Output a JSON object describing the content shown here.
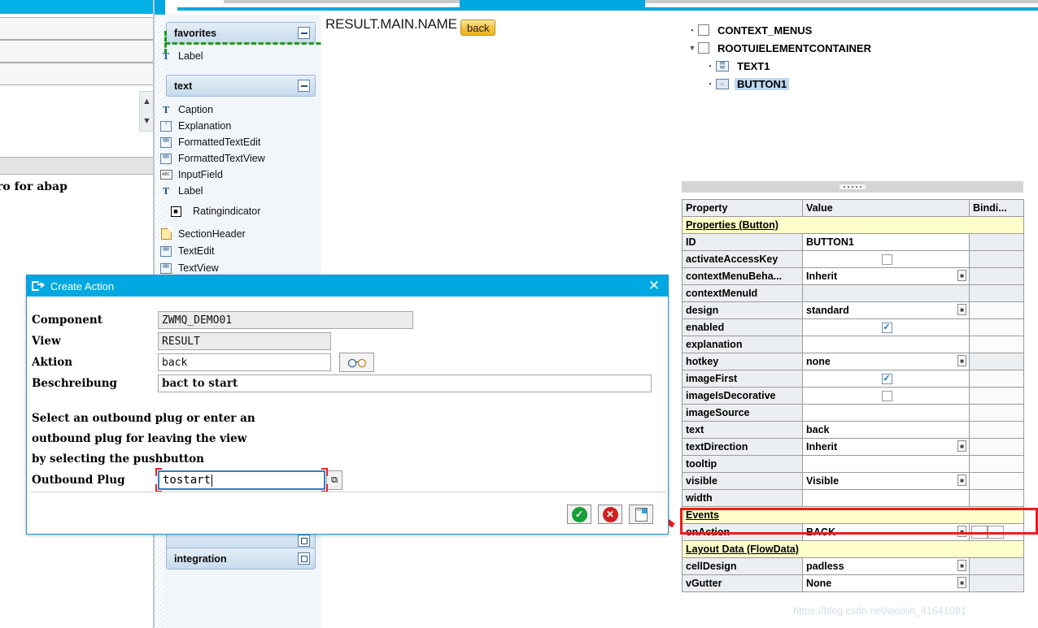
{
  "window": {
    "tabstrip_present": true,
    "watermark": "https://blog.csdn.net/weixin_41641081"
  },
  "far_left_panel": {
    "text_fragment": "ro for abap",
    "scroll_up_icon": "chevron-up-icon",
    "scroll_down_icon": "chevron-down-icon"
  },
  "palette": {
    "groups": [
      {
        "label": "favorites",
        "collapse_icon": "collapse-minus-icon"
      },
      {
        "label": "text",
        "collapse_icon": "collapse-minus-icon"
      },
      {
        "label": "integration",
        "collapse_icon": "expand-square-icon"
      }
    ],
    "favorites_items": [
      {
        "label": "Label",
        "icon": "text-T-icon"
      }
    ],
    "text_items": [
      {
        "label": "Caption",
        "icon": "text-T-icon"
      },
      {
        "label": "Explanation",
        "icon": "explanation-icon"
      },
      {
        "label": "FormattedTextEdit",
        "icon": "formatted-text-edit-icon"
      },
      {
        "label": "FormattedTextView",
        "icon": "formatted-text-view-icon"
      },
      {
        "label": "InputField",
        "icon": "input-field-icon"
      },
      {
        "label": "Label",
        "icon": "text-T-icon"
      },
      {
        "label": "Ratingindicator",
        "icon": "rating-indicator-icon"
      },
      {
        "label": "SectionHeader",
        "icon": "section-header-icon"
      },
      {
        "label": "TextEdit",
        "icon": "text-edit-icon"
      },
      {
        "label": "TextView",
        "icon": "text-view-icon"
      }
    ]
  },
  "canvas": {
    "view_label": "RESULT.MAIN.NAME",
    "button_text": "back"
  },
  "tree": {
    "nodes": [
      {
        "label": "CONTEXT_MENUS",
        "icon": "checkbox-icon",
        "selected": false,
        "expander": "dot",
        "indent": 0
      },
      {
        "label": "ROOTUIELEMENTCONTAINER",
        "icon": "checkbox-icon",
        "selected": false,
        "expander": "chevron-down-icon",
        "indent": 0
      },
      {
        "label": "TEXT1",
        "icon": "text-view-icon",
        "selected": false,
        "expander": "dot",
        "indent": 1
      },
      {
        "label": "BUTTON1",
        "icon": "button-icon",
        "selected": true,
        "expander": "dot",
        "indent": 1
      }
    ]
  },
  "properties": {
    "headers": [
      "Property",
      "Value",
      "Bindi..."
    ],
    "rows": [
      {
        "kind": "section",
        "name": "Properties (Button)"
      },
      {
        "kind": "text",
        "name": "ID",
        "value": "BUTTON1",
        "bind": false
      },
      {
        "kind": "checkbox",
        "name": "activateAccessKey",
        "checked": false,
        "bind": false
      },
      {
        "kind": "dropdown",
        "name": "contextMenuBeha...",
        "value": "Inherit",
        "bind": false
      },
      {
        "kind": "empty",
        "name": "contextMenuId",
        "value": "",
        "bind": false
      },
      {
        "kind": "dropdown",
        "name": "design",
        "value": "standard",
        "bind": true
      },
      {
        "kind": "checkbox",
        "name": "enabled",
        "checked": true,
        "bind": true
      },
      {
        "kind": "empty",
        "name": "explanation",
        "value": "",
        "bind": true
      },
      {
        "kind": "dropdown",
        "name": "hotkey",
        "value": "none",
        "bind": false
      },
      {
        "kind": "checkbox",
        "name": "imageFirst",
        "checked": true,
        "bind": true
      },
      {
        "kind": "checkbox",
        "name": "imageIsDecorative",
        "checked": false,
        "bind": true
      },
      {
        "kind": "empty",
        "name": "imageSource",
        "value": "",
        "bind": true
      },
      {
        "kind": "text",
        "name": "text",
        "value": "back",
        "bind": true
      },
      {
        "kind": "dropdown",
        "name": "textDirection",
        "value": "Inherit",
        "bind": true
      },
      {
        "kind": "empty",
        "name": "tooltip",
        "value": "",
        "bind": true
      },
      {
        "kind": "dropdown",
        "name": "visible",
        "value": "Visible",
        "bind": true
      },
      {
        "kind": "empty",
        "name": "width",
        "value": "",
        "bind": true
      },
      {
        "kind": "section",
        "name": "Events"
      },
      {
        "kind": "event",
        "name": "onAction",
        "value": "BACK",
        "bind": false,
        "highlighted": true
      },
      {
        "kind": "section",
        "name": "Layout Data (FlowData)"
      },
      {
        "kind": "dropdown",
        "name": "cellDesign",
        "value": "padless",
        "bind": false
      },
      {
        "kind": "dropdown",
        "name": "vGutter",
        "value": "None",
        "bind": false
      }
    ]
  },
  "dialog": {
    "title": "Create Action",
    "title_icon": "create-action-icon",
    "close_icon": "close-icon",
    "fields": [
      {
        "label": "Component",
        "value": "ZWMQ_DEMO01",
        "readonly": true
      },
      {
        "label": "View",
        "value": "RESULT",
        "readonly": true
      },
      {
        "label": "Aktion",
        "value": "back",
        "readonly": false
      },
      {
        "label": "Beschreibung",
        "value": "bact to start",
        "readonly": false
      }
    ],
    "aktion_help_icon": "glasses-icon",
    "instructions": [
      "Select an outbound plug or enter an",
      "outbound plug for leaving the view",
      "by selecting the pushbutton"
    ],
    "outbound_plug": {
      "label": "Outbound Plug",
      "value": "tostart",
      "help_icon": "value-help-icon"
    },
    "buttons": [
      {
        "name": "confirm",
        "icon": "green-check-icon",
        "glyph": "✔"
      },
      {
        "name": "cancel",
        "icon": "red-x-icon",
        "glyph": "✖"
      },
      {
        "name": "note",
        "icon": "note-icon",
        "glyph": ""
      }
    ]
  },
  "annotations": {
    "red_box_target": "onAction",
    "red_arrow": "points-from-onAction-to-dialog"
  }
}
